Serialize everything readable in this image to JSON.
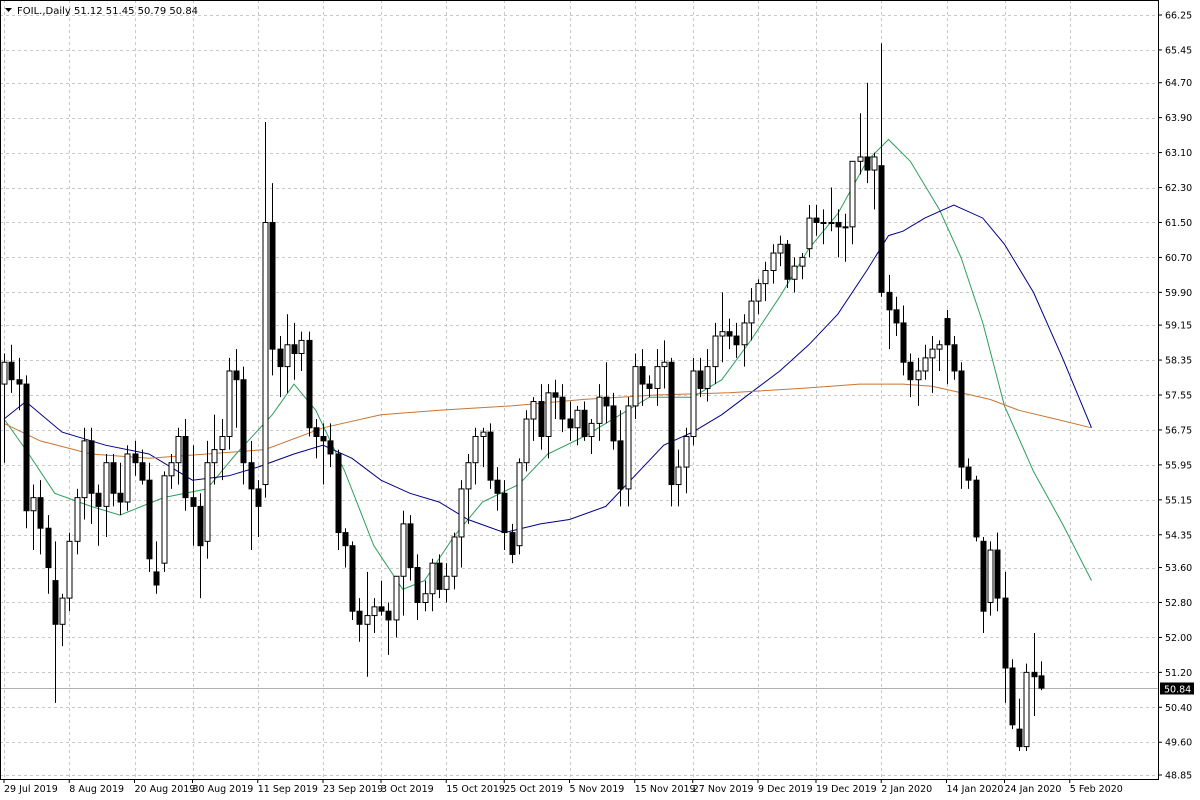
{
  "header": {
    "symbol": "FOIL.,Daily",
    "ohlc": "51.12 51.45 50.79 50.84"
  },
  "current_price_label": "50.84",
  "colors": {
    "background": "#ffffff",
    "grid": "#c8c8c8",
    "candle_up_body": "#ffffff",
    "candle_down_body": "#000000",
    "candle_outline": "#000000",
    "ma_fast": "#2e9e5b",
    "ma_mid": "#00008b",
    "ma_slow": "#c87533",
    "price_marker_bg": "#000000",
    "price_marker_text": "#ffffff",
    "price_line": "#b0b0b0"
  },
  "chart_data": {
    "type": "candlestick",
    "title": "",
    "xlabel": "",
    "ylabel": "",
    "ylim": [
      48.85,
      66.25
    ],
    "grid": true,
    "y_ticks": [
      "66.25",
      "65.45",
      "64.70",
      "63.90",
      "63.10",
      "62.30",
      "61.50",
      "60.70",
      "59.90",
      "59.15",
      "58.35",
      "57.55",
      "56.75",
      "55.95",
      "55.15",
      "54.35",
      "53.60",
      "52.80",
      "52.00",
      "51.20",
      "50.40",
      "49.60",
      "48.85"
    ],
    "x_tick_labels": [
      "29 Jul 2019",
      "8 Aug 2019",
      "20 Aug 2019",
      "30 Aug 2019",
      "11 Sep 2019",
      "23 Sep 2019",
      "3 Oct 2019",
      "15 Oct 2019",
      "25 Oct 2019",
      "5 Nov 2019",
      "15 Nov 2019",
      "27 Nov 2019",
      "9 Dec 2019",
      "19 Dec 2019",
      "2 Jan 2020",
      "14 Jan 2020",
      "24 Jan 2020",
      "5 Feb 2020"
    ],
    "x_tick_bar_index": [
      0,
      9,
      18,
      26,
      35,
      44,
      52,
      61,
      69,
      78,
      87,
      95,
      104,
      112,
      121,
      130,
      138,
      147
    ],
    "candles": [
      [
        57.8,
        58.5,
        56.0,
        58.3
      ],
      [
        58.3,
        58.7,
        57.6,
        57.9
      ],
      [
        57.9,
        58.4,
        57.2,
        57.8
      ],
      [
        57.8,
        58.0,
        54.5,
        54.9
      ],
      [
        54.9,
        55.5,
        54.0,
        55.2
      ],
      [
        55.2,
        55.6,
        53.9,
        54.5
      ],
      [
        54.5,
        54.8,
        53.0,
        53.6
      ],
      [
        53.3,
        54.2,
        50.5,
        52.3
      ],
      [
        52.3,
        53.0,
        51.8,
        52.9
      ],
      [
        52.9,
        54.4,
        52.6,
        54.2
      ],
      [
        54.2,
        55.4,
        53.9,
        55.2
      ],
      [
        55.2,
        56.8,
        54.7,
        56.5
      ],
      [
        56.5,
        56.8,
        54.6,
        55.3
      ],
      [
        55.3,
        55.5,
        54.1,
        55.0
      ],
      [
        55.0,
        56.2,
        54.3,
        56.0
      ],
      [
        56.0,
        56.2,
        55.0,
        55.3
      ],
      [
        55.3,
        56.0,
        54.8,
        55.1
      ],
      [
        55.1,
        56.4,
        54.9,
        56.2
      ],
      [
        56.2,
        56.5,
        55.7,
        56.0
      ],
      [
        56.0,
        56.3,
        55.5,
        55.6
      ],
      [
        55.6,
        56.0,
        53.5,
        53.8
      ],
      [
        53.5,
        54.2,
        53.0,
        53.2
      ],
      [
        53.7,
        55.8,
        53.5,
        55.7
      ],
      [
        55.7,
        56.2,
        55.4,
        56.0
      ],
      [
        56.0,
        56.8,
        55.5,
        56.6
      ],
      [
        56.6,
        57.0,
        54.9,
        55.2
      ],
      [
        55.2,
        56.4,
        54.1,
        55.0
      ],
      [
        55.0,
        55.3,
        52.9,
        54.1
      ],
      [
        54.2,
        56.5,
        53.8,
        56.0
      ],
      [
        56.0,
        57.1,
        55.5,
        56.3
      ],
      [
        56.3,
        57.0,
        55.6,
        56.6
      ],
      [
        56.6,
        58.4,
        56.3,
        58.1
      ],
      [
        58.1,
        58.6,
        56.8,
        57.9
      ],
      [
        57.9,
        58.2,
        55.5,
        56.0
      ],
      [
        56.0,
        56.5,
        54.0,
        55.4
      ],
      [
        55.4,
        55.6,
        54.3,
        55.0
      ],
      [
        55.5,
        63.8,
        55.2,
        61.5
      ],
      [
        61.5,
        62.4,
        58.0,
        58.6
      ],
      [
        58.6,
        58.9,
        57.5,
        58.2
      ],
      [
        58.2,
        59.4,
        57.6,
        58.7
      ],
      [
        58.7,
        59.2,
        57.9,
        58.5
      ],
      [
        58.5,
        59.0,
        58.1,
        58.8
      ],
      [
        58.8,
        59.0,
        56.6,
        56.8
      ],
      [
        56.8,
        57.0,
        56.1,
        56.6
      ],
      [
        56.6,
        56.9,
        55.5,
        56.5
      ],
      [
        56.5,
        56.9,
        55.9,
        56.2
      ],
      [
        56.2,
        56.3,
        54.0,
        54.4
      ],
      [
        54.4,
        54.5,
        53.6,
        54.1
      ],
      [
        54.1,
        54.2,
        52.4,
        52.6
      ],
      [
        52.6,
        52.9,
        51.9,
        52.3
      ],
      [
        52.3,
        53.5,
        51.1,
        52.5
      ],
      [
        52.5,
        52.9,
        52.1,
        52.7
      ],
      [
        52.7,
        53.3,
        52.5,
        52.6
      ],
      [
        52.6,
        52.8,
        51.6,
        52.4
      ],
      [
        52.4,
        53.4,
        52.0,
        53.4
      ],
      [
        53.4,
        54.9,
        52.5,
        54.6
      ],
      [
        54.6,
        54.8,
        53.3,
        53.6
      ],
      [
        53.6,
        53.9,
        52.4,
        52.8
      ],
      [
        52.8,
        53.3,
        52.6,
        53.0
      ],
      [
        53.0,
        53.8,
        52.6,
        53.7
      ],
      [
        53.7,
        53.9,
        52.9,
        53.1
      ],
      [
        53.1,
        53.7,
        52.8,
        53.4
      ],
      [
        53.4,
        54.4,
        53.1,
        54.3
      ],
      [
        54.3,
        55.6,
        53.6,
        55.4
      ],
      [
        55.4,
        56.2,
        54.6,
        56.0
      ],
      [
        56.0,
        56.8,
        55.5,
        56.6
      ],
      [
        56.6,
        56.8,
        55.9,
        56.7
      ],
      [
        56.7,
        56.9,
        55.4,
        55.6
      ],
      [
        55.6,
        55.9,
        54.9,
        55.3
      ],
      [
        55.3,
        55.6,
        54.0,
        54.4
      ],
      [
        54.4,
        54.6,
        53.7,
        53.9
      ],
      [
        54.1,
        56.1,
        53.9,
        56.0
      ],
      [
        56.0,
        57.2,
        55.8,
        57.0
      ],
      [
        57.0,
        57.5,
        56.5,
        57.4
      ],
      [
        57.4,
        57.8,
        56.3,
        56.6
      ],
      [
        56.6,
        57.8,
        56.1,
        57.6
      ],
      [
        57.6,
        57.9,
        57.0,
        57.5
      ],
      [
        57.5,
        57.8,
        56.7,
        57.0
      ],
      [
        57.0,
        57.4,
        56.5,
        56.8
      ],
      [
        56.8,
        57.3,
        56.4,
        57.2
      ],
      [
        57.2,
        57.4,
        56.5,
        56.6
      ],
      [
        56.6,
        57.0,
        56.2,
        56.9
      ],
      [
        56.9,
        57.8,
        56.5,
        57.5
      ],
      [
        57.5,
        58.3,
        56.9,
        57.3
      ],
      [
        57.3,
        57.6,
        56.3,
        56.5
      ],
      [
        56.5,
        57.2,
        55.0,
        55.4
      ],
      [
        55.4,
        57.5,
        55.0,
        57.3
      ],
      [
        57.3,
        58.5,
        57.0,
        58.2
      ],
      [
        58.2,
        58.6,
        57.3,
        57.8
      ],
      [
        57.8,
        58.0,
        57.5,
        57.7
      ],
      [
        57.7,
        58.6,
        57.3,
        58.2
      ],
      [
        58.2,
        58.8,
        57.7,
        58.3
      ],
      [
        58.3,
        58.4,
        55.0,
        55.5
      ],
      [
        55.5,
        56.3,
        55.0,
        55.9
      ],
      [
        55.9,
        56.8,
        55.3,
        56.6
      ],
      [
        56.6,
        58.4,
        56.4,
        58.1
      ],
      [
        58.1,
        58.4,
        57.5,
        57.7
      ],
      [
        57.7,
        58.6,
        57.4,
        58.2
      ],
      [
        58.2,
        59.2,
        57.8,
        58.9
      ],
      [
        58.9,
        59.9,
        58.3,
        59.0
      ],
      [
        59.0,
        59.3,
        58.6,
        58.9
      ],
      [
        58.9,
        59.2,
        58.4,
        58.7
      ],
      [
        58.7,
        59.4,
        58.2,
        59.2
      ],
      [
        59.2,
        60.0,
        58.8,
        59.7
      ],
      [
        59.7,
        60.2,
        59.4,
        60.1
      ],
      [
        60.1,
        60.6,
        59.7,
        60.4
      ],
      [
        60.4,
        61.0,
        60.1,
        60.8
      ],
      [
        60.8,
        61.2,
        60.5,
        61.0
      ],
      [
        61.0,
        61.1,
        60.0,
        60.2
      ],
      [
        60.2,
        60.7,
        59.9,
        60.5
      ],
      [
        60.5,
        60.8,
        60.2,
        60.7
      ],
      [
        60.9,
        61.9,
        60.7,
        61.6
      ],
      [
        61.6,
        61.9,
        61.2,
        61.5
      ],
      [
        61.5,
        61.8,
        61.0,
        61.5
      ],
      [
        61.5,
        62.3,
        61.3,
        61.5
      ],
      [
        61.5,
        61.8,
        60.7,
        61.4
      ],
      [
        61.4,
        61.7,
        60.6,
        61.4
      ],
      [
        61.4,
        62.5,
        61.0,
        62.9
      ],
      [
        62.9,
        64.0,
        62.6,
        63.0
      ],
      [
        63.0,
        64.7,
        62.4,
        62.7
      ],
      [
        62.7,
        63.1,
        61.8,
        63.0
      ],
      [
        62.8,
        65.6,
        59.8,
        59.9
      ],
      [
        59.9,
        60.3,
        58.6,
        59.5
      ],
      [
        59.5,
        59.8,
        58.9,
        59.2
      ],
      [
        59.2,
        59.6,
        58.0,
        58.3
      ],
      [
        58.3,
        58.5,
        57.5,
        57.9
      ],
      [
        57.9,
        58.4,
        57.3,
        58.1
      ],
      [
        58.1,
        58.7,
        57.9,
        58.4
      ],
      [
        58.4,
        58.9,
        57.6,
        58.6
      ],
      [
        58.6,
        58.8,
        58.1,
        58.7
      ],
      [
        59.3,
        59.5,
        57.8,
        58.7
      ],
      [
        58.7,
        58.9,
        57.9,
        58.1
      ],
      [
        58.1,
        58.3,
        55.4,
        55.9
      ],
      [
        55.9,
        56.1,
        55.4,
        55.6
      ],
      [
        55.6,
        55.7,
        54.2,
        54.3
      ],
      [
        54.2,
        54.3,
        52.1,
        52.6
      ],
      [
        52.8,
        54.2,
        52.5,
        54.0
      ],
      [
        54.0,
        54.4,
        52.6,
        52.9
      ],
      [
        52.9,
        53.5,
        50.5,
        51.3
      ],
      [
        51.3,
        51.5,
        49.9,
        50.0
      ],
      [
        49.9,
        50.6,
        49.4,
        49.5
      ],
      [
        49.5,
        51.4,
        49.4,
        51.2
      ],
      [
        51.2,
        52.1,
        50.2,
        51.1
      ],
      [
        51.12,
        51.45,
        50.79,
        50.84
      ]
    ],
    "series": [
      {
        "kind": "moving-average",
        "color": "#2e9e5b",
        "points": [
          [
            0,
            57.0
          ],
          [
            3,
            56.3
          ],
          [
            7,
            55.3
          ],
          [
            12,
            55.0
          ],
          [
            16,
            54.8
          ],
          [
            22,
            55.2
          ],
          [
            28,
            55.4
          ],
          [
            32,
            56.2
          ],
          [
            37,
            57.1
          ],
          [
            40,
            57.8
          ],
          [
            43,
            57.2
          ],
          [
            47,
            55.8
          ],
          [
            51,
            54.1
          ],
          [
            55,
            53.1
          ],
          [
            58,
            53.3
          ],
          [
            62,
            54.3
          ],
          [
            66,
            55.1
          ],
          [
            71,
            55.5
          ],
          [
            75,
            56.2
          ],
          [
            80,
            56.6
          ],
          [
            85,
            57.1
          ],
          [
            89,
            57.5
          ],
          [
            95,
            57.5
          ],
          [
            99,
            57.9
          ],
          [
            103,
            58.8
          ],
          [
            107,
            59.8
          ],
          [
            111,
            60.9
          ],
          [
            115,
            61.7
          ],
          [
            119,
            62.9
          ],
          [
            122,
            63.4
          ],
          [
            125,
            62.9
          ],
          [
            129,
            61.8
          ],
          [
            132,
            60.7
          ],
          [
            135,
            59.2
          ],
          [
            138,
            57.3
          ],
          [
            142,
            55.8
          ],
          [
            146,
            54.6
          ],
          [
            150,
            53.3
          ]
        ]
      },
      {
        "kind": "moving-average",
        "color": "#00008b",
        "points": [
          [
            0,
            57.0
          ],
          [
            3,
            57.4
          ],
          [
            8,
            56.7
          ],
          [
            14,
            56.4
          ],
          [
            20,
            56.2
          ],
          [
            26,
            55.6
          ],
          [
            31,
            55.7
          ],
          [
            35,
            55.9
          ],
          [
            40,
            56.2
          ],
          [
            44,
            56.4
          ],
          [
            48,
            56.1
          ],
          [
            52,
            55.6
          ],
          [
            56,
            55.3
          ],
          [
            60,
            55.1
          ],
          [
            64,
            54.7
          ],
          [
            69,
            54.4
          ],
          [
            74,
            54.6
          ],
          [
            78,
            54.7
          ],
          [
            83,
            55.0
          ],
          [
            87,
            55.7
          ],
          [
            91,
            56.4
          ],
          [
            95,
            56.7
          ],
          [
            99,
            57.1
          ],
          [
            103,
            57.6
          ],
          [
            107,
            58.1
          ],
          [
            111,
            58.7
          ],
          [
            115,
            59.4
          ],
          [
            119,
            60.4
          ],
          [
            122,
            61.2
          ],
          [
            124,
            61.3
          ],
          [
            127,
            61.6
          ],
          [
            131,
            61.9
          ],
          [
            135,
            61.6
          ],
          [
            138,
            61.0
          ],
          [
            142,
            59.9
          ],
          [
            146,
            58.4
          ],
          [
            150,
            56.8
          ]
        ]
      },
      {
        "kind": "moving-average",
        "color": "#c87533",
        "points": [
          [
            0,
            56.9
          ],
          [
            5,
            56.5
          ],
          [
            12,
            56.2
          ],
          [
            20,
            56.1
          ],
          [
            28,
            56.2
          ],
          [
            36,
            56.3
          ],
          [
            44,
            56.8
          ],
          [
            52,
            57.1
          ],
          [
            60,
            57.2
          ],
          [
            70,
            57.3
          ],
          [
            80,
            57.45
          ],
          [
            90,
            57.55
          ],
          [
            100,
            57.6
          ],
          [
            110,
            57.7
          ],
          [
            118,
            57.8
          ],
          [
            124,
            57.8
          ],
          [
            128,
            57.75
          ],
          [
            132,
            57.6
          ],
          [
            136,
            57.45
          ],
          [
            140,
            57.2
          ],
          [
            145,
            57.0
          ],
          [
            150,
            56.8
          ]
        ]
      }
    ]
  }
}
